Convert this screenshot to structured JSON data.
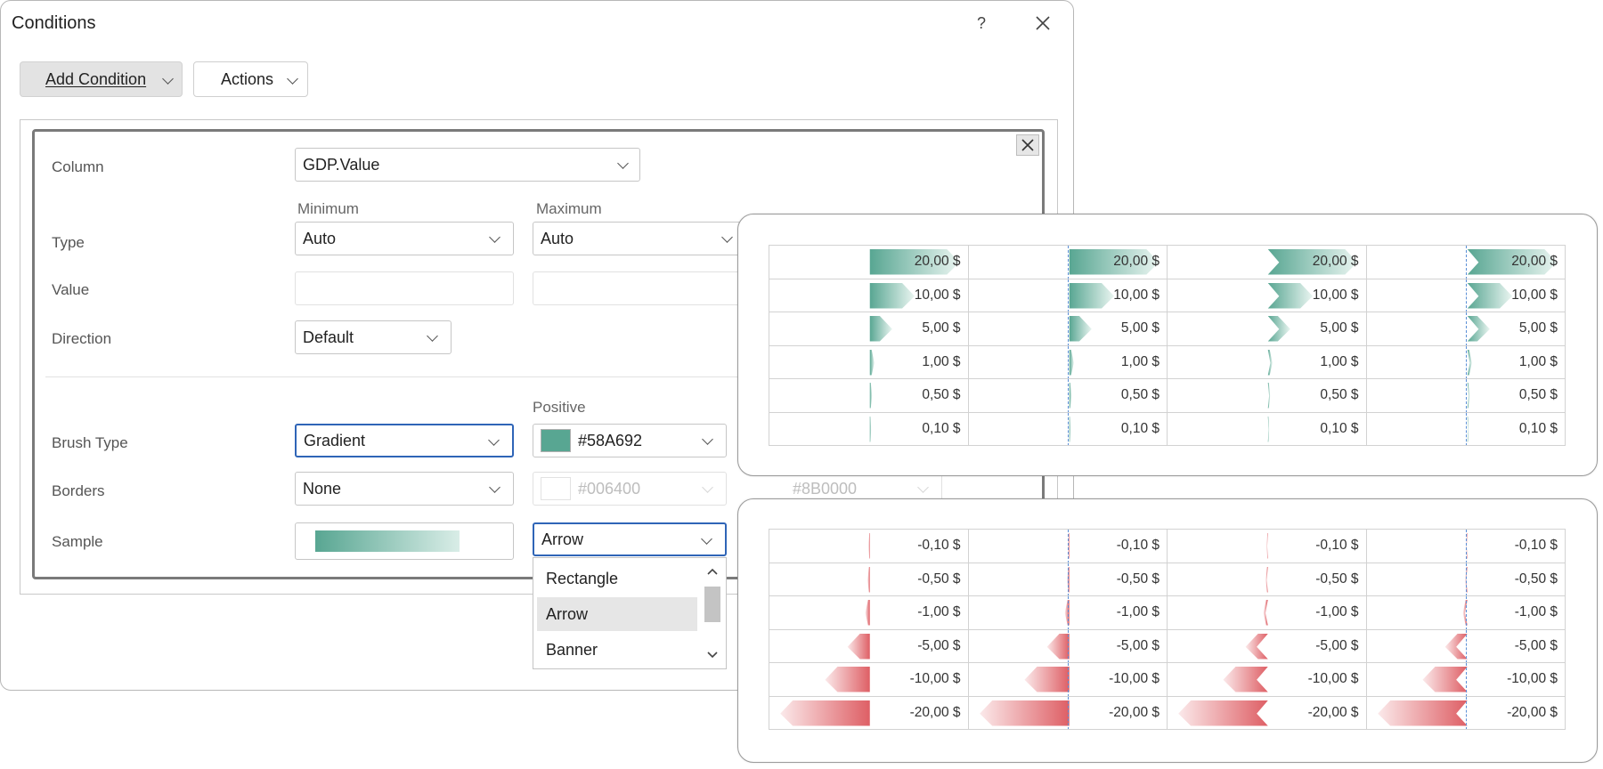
{
  "dialog": {
    "title": "Conditions",
    "help_label": "?",
    "close_label": "✕"
  },
  "toolbar": {
    "add_condition_label": "Add Condition",
    "actions_label": "Actions"
  },
  "form": {
    "column_label": "Column",
    "column_value": "GDP.Value",
    "minimum_header": "Minimum",
    "maximum_header": "Maximum",
    "type_label": "Type",
    "type_min_value": "Auto",
    "type_max_value": "Auto",
    "value_label": "Value",
    "direction_label": "Direction",
    "direction_value": "Default",
    "positive_header": "Positive",
    "brush_type_label": "Brush Type",
    "brush_type_value": "Gradient",
    "positive_color": "#58A692",
    "borders_label": "Borders",
    "borders_value": "None",
    "border_positive_color": "#006400",
    "border_negative_color": "#8B0000",
    "sample_label": "Sample",
    "shape_value": "Arrow",
    "shape_options": [
      "Rectangle",
      "Arrow",
      "Banner"
    ],
    "shape_selected_index": 1
  },
  "colors": {
    "positive": "#58A692",
    "negative": "#DE5F65",
    "focus": "#2F65B7"
  },
  "preview_positive": {
    "values": [
      "20,00 $",
      "10,00 $",
      "5,00 $",
      "1,00 $",
      "0,50 $",
      "0,10 $"
    ],
    "magnitudes": [
      20,
      10,
      5,
      1,
      0.5,
      0.1
    ]
  },
  "preview_negative": {
    "values": [
      "-0,10 $",
      "-0,50 $",
      "-1,00 $",
      "-5,00 $",
      "-10,00 $",
      "-20,00 $"
    ],
    "magnitudes": [
      0.1,
      0.5,
      1,
      5,
      10,
      20
    ]
  }
}
